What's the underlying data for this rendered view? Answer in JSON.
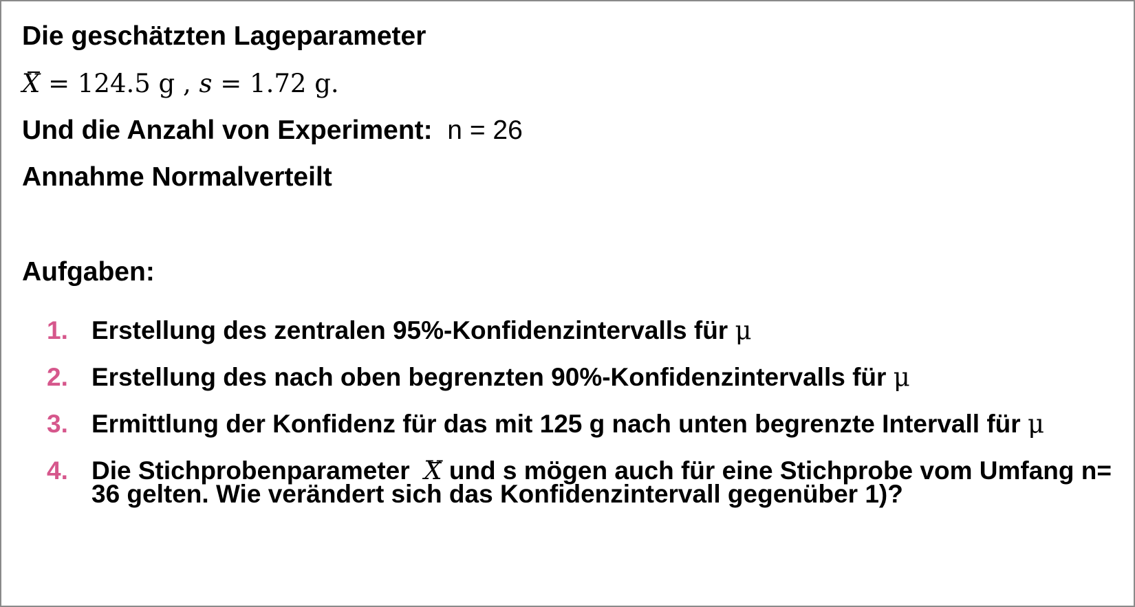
{
  "slide": {
    "heading": "Die  geschätzten Lageparameter",
    "formula": {
      "xbar_symbol": "X",
      "equals1": " = 124.5 g , ",
      "s_symbol": "s",
      "equals2": " = 1.72 g."
    },
    "count_label": "Und die Anzahl von Experiment:",
    "count_value": "n = 26",
    "assumption": "Annahme Normalverteilt",
    "tasks_title": "Aufgaben:",
    "tasks": [
      {
        "number": "1.",
        "text": "Erstellung des zentralen 95%-Konfidenzintervalls für",
        "symbol": "μ"
      },
      {
        "number": "2.",
        "text": "Erstellung des nach oben begrenzten 90%-Konfidenzintervalls für",
        "symbol": "μ"
      },
      {
        "number": "3.",
        "text": "Ermittlung der Konfidenz für das mit 125 g nach unten begrenzte Intervall für",
        "symbol": "μ"
      },
      {
        "number": "4.",
        "text_before": "Die Stichprobenparameter",
        "xbar_symbol": "X",
        "text_after": "und s mögen auch für eine Stichprobe vom Umfang n= 36 gelten. Wie verändert sich das Konfidenzintervall gegenüber 1)?"
      }
    ]
  },
  "colors": {
    "accent_number": "#d6578c",
    "border": "#8a8a8a"
  }
}
